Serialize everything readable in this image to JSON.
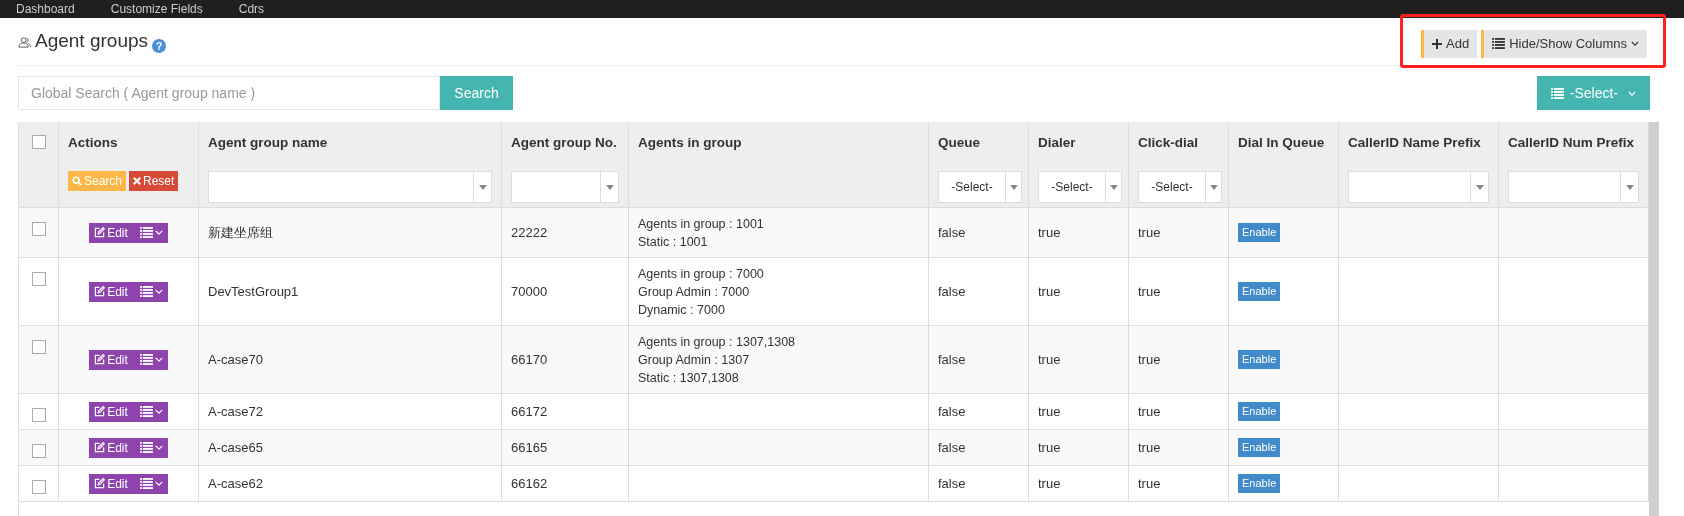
{
  "nav": [
    "Dashboard",
    "Customize Fields",
    "Cdrs"
  ],
  "page": {
    "title": "Agent groups",
    "help": "?",
    "buttons": [
      {
        "kind": "add",
        "label": "Add"
      },
      {
        "kind": "columns",
        "label": "Hide/Show Columns"
      }
    ]
  },
  "search": {
    "placeholder": "Global Search ( Agent group name )",
    "button": "Search",
    "select": "-Select-"
  },
  "table": {
    "select_all": {
      "checked": false
    },
    "columns": [
      {
        "label": "Actions",
        "kind": "actions",
        "search": "Search",
        "reset": "Reset"
      },
      {
        "label": "Agent group name",
        "kind": "text"
      },
      {
        "label": "Agent group No.",
        "kind": "text"
      },
      {
        "label": "Agents in group",
        "kind": "none"
      },
      {
        "label": "Queue",
        "kind": "select",
        "filter_value": "-Select-"
      },
      {
        "label": "Dialer",
        "kind": "select",
        "filter_value": "-Select-"
      },
      {
        "label": "Click-dial",
        "kind": "select",
        "filter_value": "-Select-"
      },
      {
        "label": "Dial In Queue",
        "kind": "none"
      },
      {
        "label": "CallerID Name Prefix",
        "kind": "text"
      },
      {
        "label": "CallerID Num Prefix",
        "kind": "text"
      }
    ],
    "rows": [
      {
        "checked": false,
        "edit": "Edit",
        "name": "新建坐席组",
        "number": "22222",
        "agents": [
          "Agents in group : 1001",
          "Static : 1001"
        ],
        "queue": "false",
        "dialer": "true",
        "click_dial": "true",
        "dial_in_queue": "Enable"
      },
      {
        "checked": false,
        "edit": "Edit",
        "name": "DevTestGroup1",
        "number": "70000",
        "agents": [
          "Agents in group : 7000",
          "Group Admin : 7000",
          "Dynamic : 7000"
        ],
        "queue": "false",
        "dialer": "true",
        "click_dial": "true",
        "dial_in_queue": "Enable"
      },
      {
        "checked": false,
        "edit": "Edit",
        "name": "A-case70",
        "number": "66170",
        "agents": [
          "Agents in group : 1307,1308",
          "Group Admin : 1307",
          "Static : 1307,1308"
        ],
        "queue": "false",
        "dialer": "true",
        "click_dial": "true",
        "dial_in_queue": "Enable"
      },
      {
        "checked": false,
        "edit": "Edit",
        "name": "A-case72",
        "number": "66172",
        "agents": [],
        "queue": "false",
        "dialer": "true",
        "click_dial": "true",
        "dial_in_queue": "Enable"
      },
      {
        "checked": false,
        "edit": "Edit",
        "name": "A-case65",
        "number": "66165",
        "agents": [],
        "queue": "false",
        "dialer": "true",
        "click_dial": "true",
        "dial_in_queue": "Enable"
      },
      {
        "checked": false,
        "edit": "Edit",
        "name": "A-case62",
        "number": "66162",
        "agents": [],
        "queue": "false",
        "dialer": "true",
        "click_dial": "true",
        "dial_in_queue": "Enable"
      }
    ]
  }
}
